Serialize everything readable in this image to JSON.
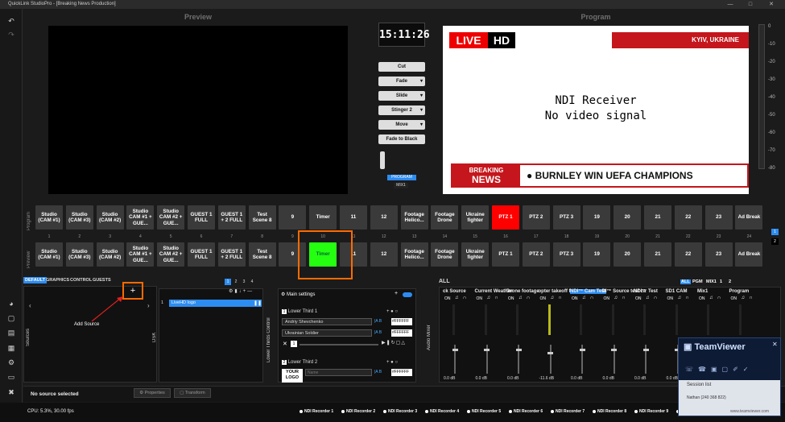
{
  "window": {
    "title": "QuickLink StudioPro - [Breaking News Production]"
  },
  "panels": {
    "preview_title": "Preview",
    "program_title": "Program"
  },
  "clock": "15:11:26",
  "transitions": [
    {
      "label": "Cut",
      "dropdown": false
    },
    {
      "label": "Fade",
      "dropdown": true
    },
    {
      "label": "Slide",
      "dropdown": true
    },
    {
      "label": "Stinger 2",
      "dropdown": true
    },
    {
      "label": "Move",
      "dropdown": true
    },
    {
      "label": "Fade to Black",
      "dropdown": false
    }
  ],
  "program_badge": "PROGRAM",
  "mix_badge": "MIX1",
  "program_feed": {
    "live": "LIVE",
    "hd": "HD",
    "location": "KYIV, UKRAINE",
    "receiver_line1": "NDI Receiver",
    "receiver_line2": "No video signal",
    "breaking": "BREAKING",
    "news": "NEWS",
    "ticker": "BURNLEY WIN UEFA CHAMPIONS"
  },
  "meter_ticks": [
    "0",
    "-10",
    "-20",
    "-30",
    "-40",
    "-50",
    "-60",
    "-70",
    "-80"
  ],
  "row_labels": {
    "program": "Program",
    "preview": "Preview"
  },
  "sources": [
    {
      "label": "Studio (CAM #1)"
    },
    {
      "label": "Studio (CAM #3)"
    },
    {
      "label": "Studio (CAM #2)"
    },
    {
      "label": "Studio CAM #1 + GUE..."
    },
    {
      "label": "Studio CAM #2 + GUE..."
    },
    {
      "label": "GUEST 1 FULL"
    },
    {
      "label": "GUEST 1 + 2 FULL"
    },
    {
      "label": "Test Scene 8"
    },
    {
      "label": "9"
    },
    {
      "label": "Timer"
    },
    {
      "label": "11"
    },
    {
      "label": "12"
    },
    {
      "label": "Footage Helico..."
    },
    {
      "label": "Footage Drone"
    },
    {
      "label": "Ukraine fighter"
    },
    {
      "label": "PTZ 1"
    },
    {
      "label": "PTZ 2"
    },
    {
      "label": "PTZ 3"
    },
    {
      "label": "19"
    },
    {
      "label": "20"
    },
    {
      "label": "21"
    },
    {
      "label": "22"
    },
    {
      "label": "23"
    },
    {
      "label": "Ad Break"
    }
  ],
  "program_selected": 16,
  "preview_selected": 10,
  "page_numbers": [
    "1",
    "2"
  ],
  "col_numbers": [
    "1",
    "2",
    "3",
    "4",
    "5",
    "6",
    "7",
    "8",
    "9",
    "10",
    "11",
    "12",
    "13",
    "14",
    "15",
    "16",
    "17",
    "18",
    "19",
    "20",
    "21",
    "22",
    "23",
    "24"
  ],
  "tabs": [
    "DEFAULT",
    "GRAPHICS",
    "CONTROL",
    "GUESTS"
  ],
  "source_pages": [
    "1",
    "2",
    "3",
    "4"
  ],
  "sources_label": "Sources",
  "add_source_label": "Add Source",
  "dsk_label": "DSK",
  "dsk_item": "LiveHD logo",
  "dsk_index": "1",
  "lower_thirds_label": "Lower Thirds Control",
  "main_settings": "Main settings",
  "lower_third_1": {
    "index": "1",
    "title": "Lower Third 1",
    "rows": [
      "Andriy Shevchenko",
      "Ukrainian Soldier"
    ],
    "color": "#FFFFFF",
    "close_index": "1"
  },
  "lower_third_2": {
    "index": "2",
    "title": "Lower Third 2",
    "logo": "YOUR LOGO",
    "name_placeholder": "Name",
    "color": "#FFFFFF"
  },
  "audio": {
    "label": "ALL",
    "mixer_label": "Audio Mixer",
    "tabs": [
      "ALL",
      "PGM",
      "MIX1",
      "1",
      "2"
    ],
    "channels": [
      "ck Source",
      "Current Weather",
      "Drone footage",
      "opter takeoff foo",
      "NDI™ Cam Test",
      "DI™ Source test ca",
      "NDI™ Test",
      "SD1 CAM",
      "Mix1",
      "Program"
    ],
    "on": "ON",
    "db": [
      "0.0 dB",
      "0.0 dB",
      "0.0 dB",
      "-11.6 dB",
      "0.0 dB",
      "0.0 dB",
      "0.0 dB",
      "0.0 dB",
      "0.0 dB",
      "0.0 dB"
    ]
  },
  "status": {
    "no_source": "No source selected",
    "properties": "Properties",
    "transform": "Transform",
    "cpu": "CPU: 5.3%, 30.00 fps"
  },
  "recorders": [
    "NDI Recorder 1",
    "NDI Recorder 2",
    "NDI Recorder 3",
    "NDI Recorder 4",
    "NDI Recorder 5",
    "NDI Recorder 6",
    "NDI Recorder 7",
    "NDI Recorder 8",
    "NDI Recorder 9",
    "NDI Recorder 10"
  ],
  "teamviewer": {
    "brand": "TeamViewer",
    "session_list": "Session list",
    "session_user": "Nathan (240 368 822)",
    "site": "www.teamviewer.com"
  },
  "colors": {
    "accent": "#2d8cf0",
    "program_active": "#ff0000",
    "preview_active": "#25ff10",
    "highlight": "#ff6a00"
  }
}
